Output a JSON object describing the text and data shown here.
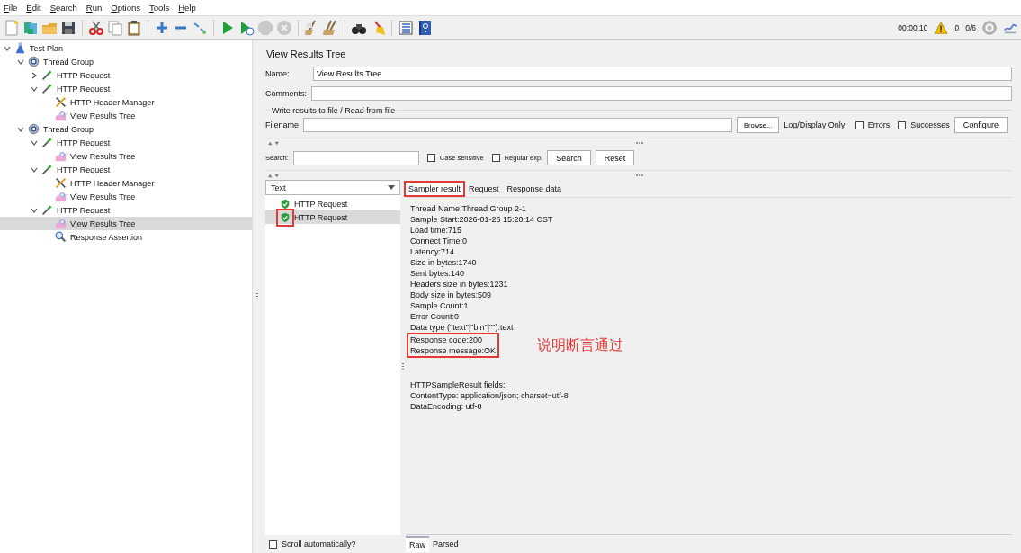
{
  "menu": [
    "File",
    "Edit",
    "Search",
    "Run",
    "Options",
    "Tools",
    "Help"
  ],
  "status": {
    "elapsed": "00:00:10",
    "warnings": "0",
    "threads": "0/6"
  },
  "tree": [
    {
      "label": "Test Plan",
      "kind": "plan",
      "expanded": true,
      "selected": false,
      "children": [
        {
          "label": "Thread Group",
          "kind": "thread-group",
          "expanded": true,
          "selected": false,
          "children": [
            {
              "label": "HTTP Request",
              "kind": "sampler",
              "expanded": false,
              "selected": false
            },
            {
              "label": "HTTP Request",
              "kind": "sampler",
              "expanded": true,
              "selected": false,
              "children": [
                {
                  "label": "HTTP Header Manager",
                  "kind": "header-manager",
                  "selected": false
                },
                {
                  "label": "View Results Tree",
                  "kind": "listener",
                  "selected": false
                }
              ]
            }
          ]
        },
        {
          "label": "Thread Group",
          "kind": "thread-group",
          "expanded": true,
          "selected": false,
          "children": [
            {
              "label": "HTTP Request",
              "kind": "sampler",
              "expanded": true,
              "selected": false,
              "children": [
                {
                  "label": "View Results Tree",
                  "kind": "listener",
                  "selected": false
                }
              ]
            },
            {
              "label": "HTTP Request",
              "kind": "sampler",
              "expanded": true,
              "selected": false,
              "children": [
                {
                  "label": "HTTP Header Manager",
                  "kind": "header-manager",
                  "selected": false
                },
                {
                  "label": "View Results Tree",
                  "kind": "listener",
                  "selected": false
                }
              ]
            },
            {
              "label": "HTTP Request",
              "kind": "sampler",
              "expanded": true,
              "selected": false,
              "children": [
                {
                  "label": "View Results Tree",
                  "kind": "listener",
                  "selected": true
                },
                {
                  "label": "Response Assertion",
                  "kind": "assertion",
                  "selected": false
                }
              ]
            }
          ]
        }
      ]
    }
  ],
  "panel": {
    "title": "View Results Tree",
    "name_label": "Name:",
    "name_value": "View Results Tree",
    "comments_label": "Comments:",
    "file_group": "Write results to file / Read from file",
    "filename_label": "Filename",
    "browse_button": "Browse...",
    "log_label": "Log/Display Only:",
    "errors": {
      "label": "Errors",
      "checked": false
    },
    "successes": {
      "label": "Successes",
      "checked": false
    },
    "configure_button": "Configure",
    "search_label": "Search:",
    "case_sensitive": {
      "label": "Case sensitive",
      "checked": false
    },
    "regular_exp": {
      "label": "Regular exp.",
      "checked": false
    },
    "search_button": "Search",
    "reset_button": "Reset"
  },
  "results": {
    "renderer": "Text",
    "items": [
      {
        "label": "HTTP Request",
        "passed": true,
        "selected": false,
        "annotated": false
      },
      {
        "label": "HTTP Request",
        "passed": true,
        "selected": true,
        "annotated": true
      }
    ],
    "scroll_auto": {
      "label": "Scroll automatically?",
      "checked": false
    }
  },
  "detail": {
    "tabs": [
      {
        "label": "Sampler result",
        "selected": true,
        "annotated": true
      },
      {
        "label": "Request",
        "selected": false,
        "annotated": false
      },
      {
        "label": "Response data",
        "selected": false,
        "annotated": false
      }
    ],
    "lines": [
      "Thread Name:Thread Group 2-1",
      "Sample Start:2026-01-26 15:20:14 CST",
      "Load time:715",
      "Connect Time:0",
      "Latency:714",
      "Size in bytes:1740",
      "Sent bytes:140",
      "Headers size in bytes:1231",
      "Body size in bytes:509",
      "Sample Count:1",
      "Error Count:0",
      "Data type (\"text\"|\"bin\"|\"\"):text"
    ],
    "highlighted_lines": [
      "Response code:200",
      "Response message:OK"
    ],
    "note": "说明断言通过",
    "field_lines": [
      "HTTPSampleResult fields:",
      "ContentType: application/json; charset=utf-8",
      "DataEncoding: utf-8"
    ],
    "view_tabs": [
      {
        "label": "Raw",
        "selected": true
      },
      {
        "label": "Parsed",
        "selected": false
      }
    ]
  }
}
